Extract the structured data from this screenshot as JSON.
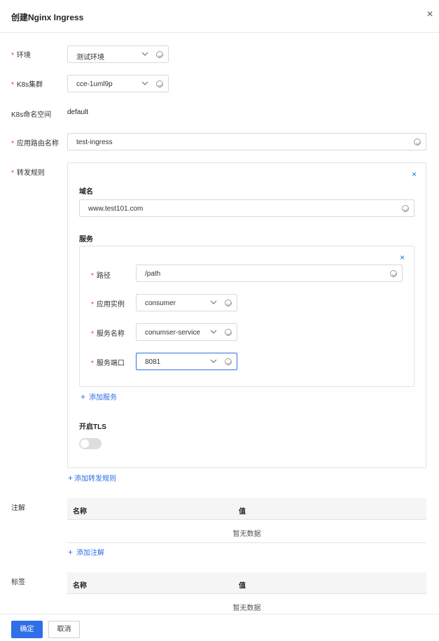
{
  "dialog": {
    "title": "创建Nginx Ingress",
    "close": "×"
  },
  "form": {
    "env": {
      "label": "环境",
      "value": "测试环境"
    },
    "cluster": {
      "label": "K8s集群",
      "value": "cce-1uml9p"
    },
    "namespace": {
      "label": "K8s命名空间",
      "value": "default"
    },
    "route_name": {
      "label": "应用路由名称",
      "value": "test-ingress"
    },
    "rules": {
      "label": "转发规则",
      "domain_label": "域名",
      "domain_value": "www.test101.com",
      "service_label": "服务",
      "path": {
        "label": "路径",
        "value": "/path"
      },
      "instance": {
        "label": "应用实例",
        "value": "consumer"
      },
      "service_name": {
        "label": "服务名称",
        "value": "conumser-service"
      },
      "service_port": {
        "label": "服务端口",
        "value": "8081"
      },
      "add_service": "添加服务",
      "tls_label": "开启TLS",
      "add_rule": "添加转发规则"
    },
    "annotations": {
      "label": "注解",
      "col_name": "名称",
      "col_value": "值",
      "empty": "暂无数据",
      "add": "添加注解"
    },
    "tags": {
      "label": "标签",
      "col_name": "名称",
      "col_value": "值",
      "empty": "暂无数据"
    }
  },
  "footer": {
    "confirm": "确定",
    "cancel": "取消"
  },
  "colors": {
    "primary": "#2f6fe8",
    "required": "#e53935"
  }
}
